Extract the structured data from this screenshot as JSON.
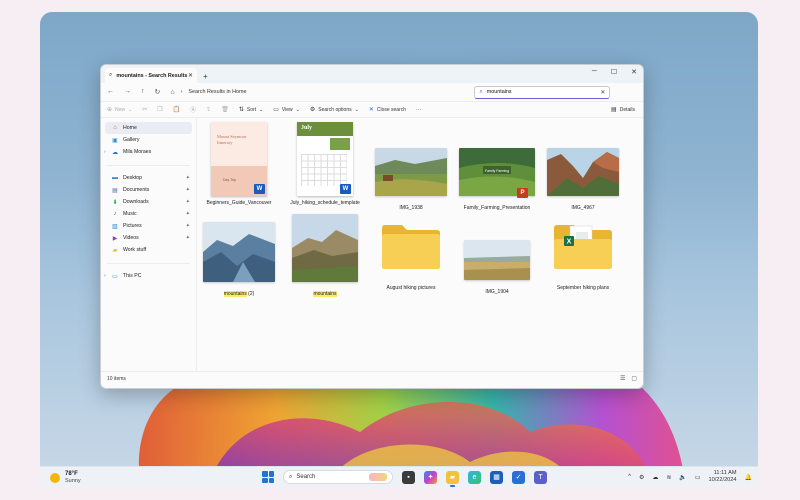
{
  "window": {
    "tab_title": "mountains - Search Results i",
    "breadcrumb": "Search Results in Home",
    "search_value": "mountains"
  },
  "commandbar": {
    "new": "New",
    "sort": "Sort",
    "view": "View",
    "search_options": "Search options",
    "close_search": "Close search",
    "details": "Details"
  },
  "sidebar": {
    "items": [
      {
        "label": "Home"
      },
      {
        "label": "Gallery"
      },
      {
        "label": "Mila Moraes"
      },
      {
        "label": "Desktop"
      },
      {
        "label": "Documents"
      },
      {
        "label": "Downloads"
      },
      {
        "label": "Music"
      },
      {
        "label": "Pictures"
      },
      {
        "label": "Videos"
      },
      {
        "label": "Work stuff"
      },
      {
        "label": "This PC"
      }
    ]
  },
  "files": {
    "beginners_guide": {
      "name": "Beginners_Guide_Vancouver",
      "doc_title": "Mount Seymour Itinerary",
      "doc_sub": "Day Trip"
    },
    "july_schedule": {
      "name": "July_hiking_schedule_template",
      "doc_title": "July"
    },
    "img_1938": {
      "name": "IMG_1938"
    },
    "family_farming": {
      "name": "Family_Farming_Presentation",
      "slide_title": "Family Farming"
    },
    "img_4967": {
      "name": "IMG_4967"
    },
    "mountains2": {
      "name_hl": "mountains",
      "name_rest": " (2)"
    },
    "mountains": {
      "name_hl": "mountains"
    },
    "august_folder": {
      "name": "August hiking pictures"
    },
    "img_1904": {
      "name": "IMG_1904"
    },
    "september_folder": {
      "name": "September hiking plans"
    }
  },
  "status": {
    "count": "10 items"
  },
  "taskbar": {
    "temperature": "78°F",
    "condition": "Sunny",
    "search_label": "Search",
    "time": "11:11 AM",
    "date": "10/22/2024"
  },
  "colors": {
    "accent": "#7b5ad6",
    "word": "#185abd",
    "powerpoint": "#c43e1c",
    "folder": "#f5c543",
    "highlight": "#fde96b"
  }
}
